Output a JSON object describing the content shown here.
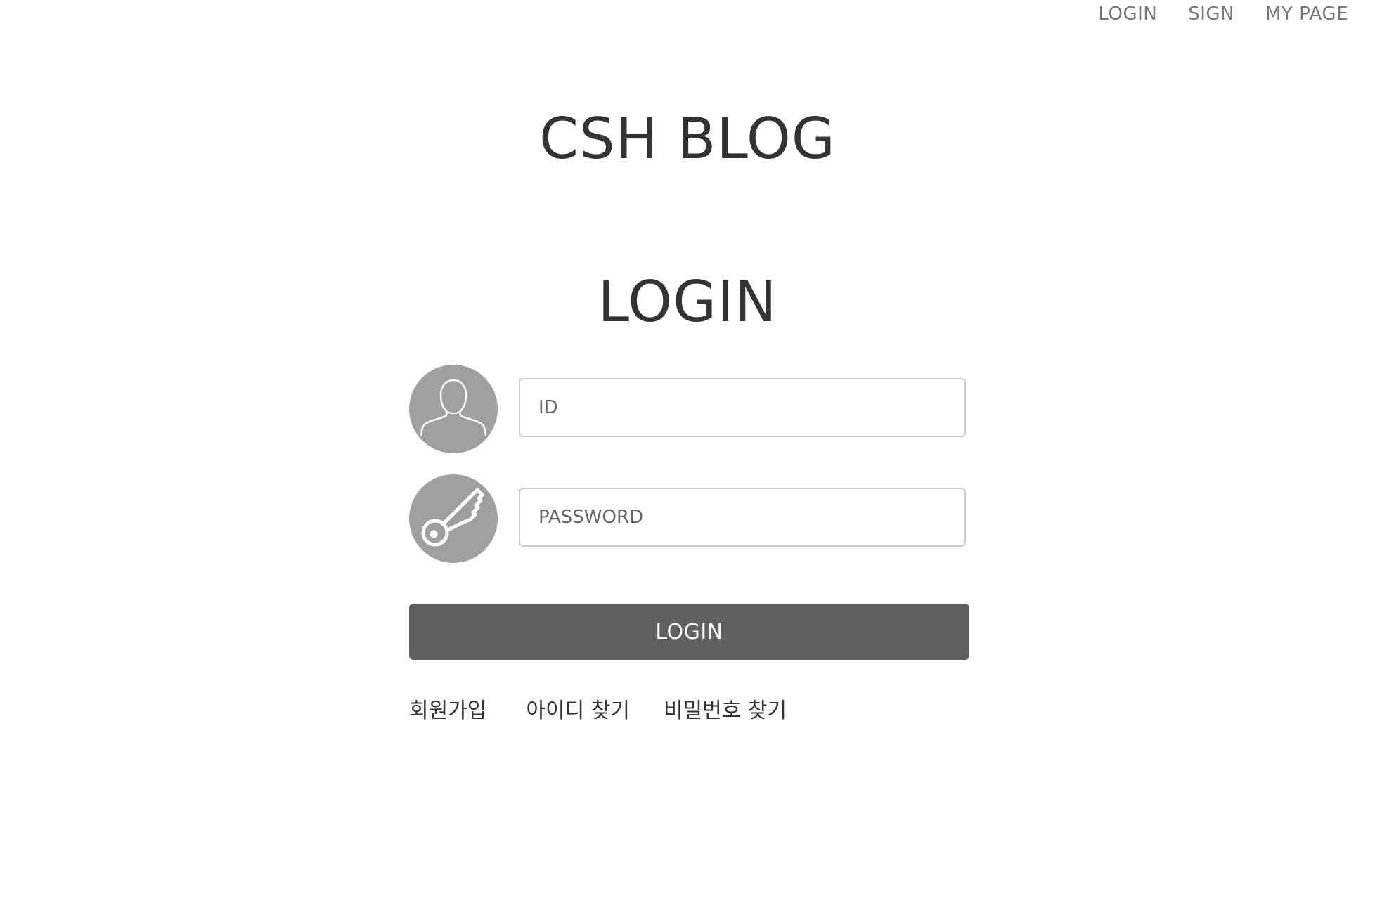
{
  "nav": {
    "login": "LOGIN",
    "sign": "SIGN",
    "mypage": "MY PAGE"
  },
  "site": {
    "title": "CSH BLOG"
  },
  "login": {
    "heading": "LOGIN",
    "id_placeholder": "ID",
    "password_placeholder": "PASSWORD",
    "submit_label": "LOGIN",
    "user_icon": "user-silhouette-icon",
    "key_icon": "key-icon"
  },
  "links": {
    "signup": "회원가입",
    "find_id": "아이디 찾기",
    "find_password": "비밀번호 찾기"
  },
  "colors": {
    "icon_circle": "#a0a0a0",
    "button": "#606060",
    "input_border": "#cccccc",
    "nav_text": "#777777"
  }
}
